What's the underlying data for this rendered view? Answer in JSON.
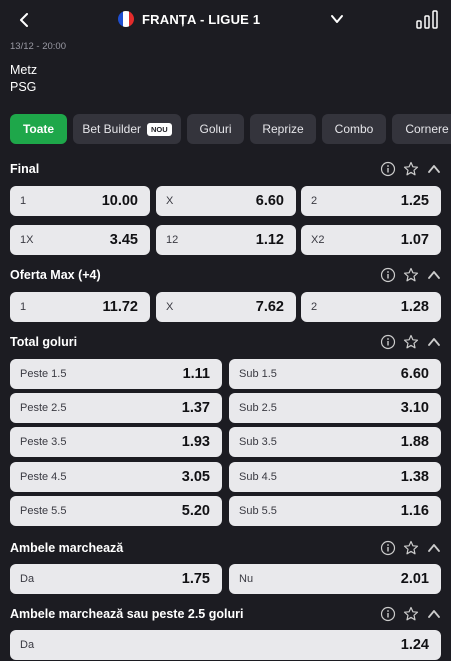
{
  "header": {
    "back_icon": "chevron-left-icon",
    "flag_colors": [
      "#1f4fd0",
      "#ffffff",
      "#e32b2b"
    ],
    "title": "FRANȚA - LIGUE 1",
    "dropdown_icon": "chevron-down-icon",
    "stats_icon": "bar-chart-icon"
  },
  "match": {
    "datetime": "13/12 - 20:00",
    "home": "Metz",
    "away": "PSG"
  },
  "filters": [
    "Toate",
    "Bet Builder",
    "Goluri",
    "Reprize",
    "Combo",
    "Cornere"
  ],
  "filter_badge": "NOU",
  "sections": {
    "final": {
      "title": "Final",
      "rows": [
        [
          {
            "label": "1",
            "odd": "10.00"
          },
          {
            "label": "X",
            "odd": "6.60"
          },
          {
            "label": "2",
            "odd": "1.25"
          }
        ],
        [
          {
            "label": "1X",
            "odd": "3.45"
          },
          {
            "label": "12",
            "odd": "1.12"
          },
          {
            "label": "X2",
            "odd": "1.07"
          }
        ]
      ]
    },
    "oferta_max": {
      "title": "Oferta Max (+4)",
      "rows": [
        [
          {
            "label": "1",
            "odd": "11.72"
          },
          {
            "label": "X",
            "odd": "7.62"
          },
          {
            "label": "2",
            "odd": "1.28"
          }
        ]
      ]
    },
    "total_goluri": {
      "title": "Total goluri",
      "rows": [
        [
          {
            "label": "Peste 1.5",
            "odd": "1.11"
          },
          {
            "label": "Sub 1.5",
            "odd": "6.60"
          }
        ],
        [
          {
            "label": "Peste 2.5",
            "odd": "1.37"
          },
          {
            "label": "Sub 2.5",
            "odd": "3.10"
          }
        ],
        [
          {
            "label": "Peste 3.5",
            "odd": "1.93"
          },
          {
            "label": "Sub 3.5",
            "odd": "1.88"
          }
        ],
        [
          {
            "label": "Peste 4.5",
            "odd": "3.05"
          },
          {
            "label": "Sub 4.5",
            "odd": "1.38"
          }
        ],
        [
          {
            "label": "Peste 5.5",
            "odd": "5.20"
          },
          {
            "label": "Sub 5.5",
            "odd": "1.16"
          }
        ]
      ]
    },
    "ambele": {
      "title": "Ambele marchează",
      "rows": [
        [
          {
            "label": "Da",
            "odd": "1.75"
          },
          {
            "label": "Nu",
            "odd": "2.01"
          }
        ]
      ]
    },
    "ambele_peste": {
      "title": "Ambele marchează sau peste 2.5 goluri",
      "rows": [
        [
          {
            "label": "Da",
            "odd": "1.24"
          }
        ]
      ]
    }
  },
  "section_icons": [
    "info-icon",
    "star-icon",
    "chevron-up-icon"
  ],
  "colors": {
    "background": "#1c1c22",
    "chip": "#34343c",
    "active_chip": "#1ea74a",
    "odd_tile": "#e9e9ec"
  }
}
